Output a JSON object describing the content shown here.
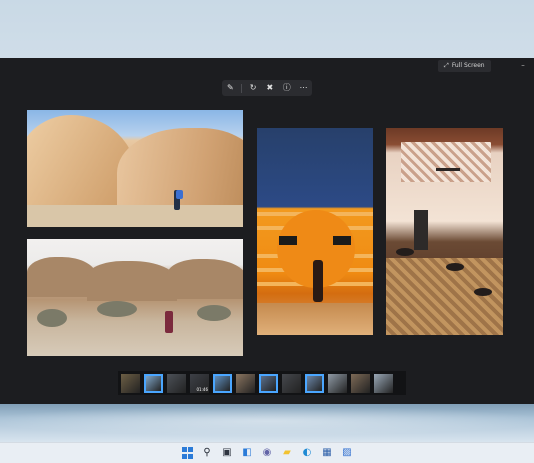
{
  "window": {
    "fullscreen_label": "Full Screen",
    "fullscreen_icon": "expand-icon",
    "minimize_icon": "minimize-icon"
  },
  "toolbar": {
    "buttons": [
      {
        "name": "edit-icon",
        "glyph": "✎"
      },
      {
        "name": "rotate-icon",
        "glyph": "↻"
      },
      {
        "name": "delete-icon",
        "glyph": "🗑"
      },
      {
        "name": "info-icon",
        "glyph": "ⓘ"
      },
      {
        "name": "more-icon",
        "glyph": "⋯"
      }
    ]
  },
  "photos": [
    {
      "name": "photo-desert-boulders-hiker"
    },
    {
      "name": "photo-desert-hills-person"
    },
    {
      "name": "photo-orange-wall-silhouette"
    },
    {
      "name": "photo-restaurant-interior"
    }
  ],
  "filmstrip": {
    "thumbs": [
      {
        "selected": false,
        "tone": "#6d5f45"
      },
      {
        "selected": true,
        "tone": "#7fa6c8"
      },
      {
        "selected": false,
        "tone": "#4c5158"
      },
      {
        "selected": false,
        "tone": "#3d4047",
        "tag": "01:46"
      },
      {
        "selected": true,
        "tone": "#5f8fbf"
      },
      {
        "selected": false,
        "tone": "#8a7560"
      },
      {
        "selected": true,
        "tone": "#5a6f8c"
      },
      {
        "selected": false,
        "tone": "#45484d"
      },
      {
        "selected": true,
        "tone": "#6b86a8"
      },
      {
        "selected": false,
        "tone": "#8f9aa5"
      },
      {
        "selected": false,
        "tone": "#7d6a56"
      },
      {
        "selected": false,
        "tone": "#9aa9b8"
      }
    ]
  },
  "taskbar": {
    "icons": [
      {
        "name": "start-icon",
        "glyph": "",
        "color": "#2b7bd8"
      },
      {
        "name": "search-icon",
        "glyph": "⚲",
        "color": "#1f2530"
      },
      {
        "name": "task-view-icon",
        "glyph": "▣",
        "color": "#2e3440"
      },
      {
        "name": "widgets-icon",
        "glyph": "◧",
        "color": "#2b7bd8"
      },
      {
        "name": "teams-chat-icon",
        "glyph": "◉",
        "color": "#6264a7"
      },
      {
        "name": "file-explorer-icon",
        "glyph": "▰",
        "color": "#f2c230"
      },
      {
        "name": "edge-icon",
        "glyph": "◐",
        "color": "#1f8ad4"
      },
      {
        "name": "store-icon",
        "glyph": "▦",
        "color": "#2b5ea8"
      },
      {
        "name": "photos-icon",
        "glyph": "▨",
        "color": "#2f6fd0"
      }
    ]
  }
}
